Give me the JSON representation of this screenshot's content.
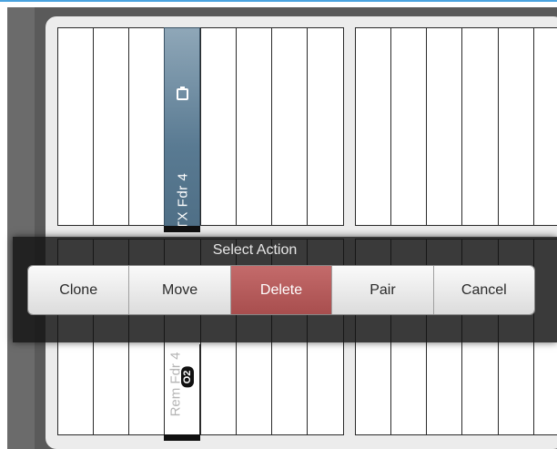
{
  "tx_channel": {
    "label": "TX Fdr 4",
    "icon": "clipboard-icon"
  },
  "rem_channel": {
    "label": "Rem Fdr 4",
    "badge": "O2"
  },
  "action_popup": {
    "title": "Select Action",
    "buttons": [
      {
        "label": "Clone"
      },
      {
        "label": "Move"
      },
      {
        "label": "Delete",
        "color": "#b05656"
      },
      {
        "label": "Pair"
      },
      {
        "label": "Cancel"
      }
    ]
  }
}
